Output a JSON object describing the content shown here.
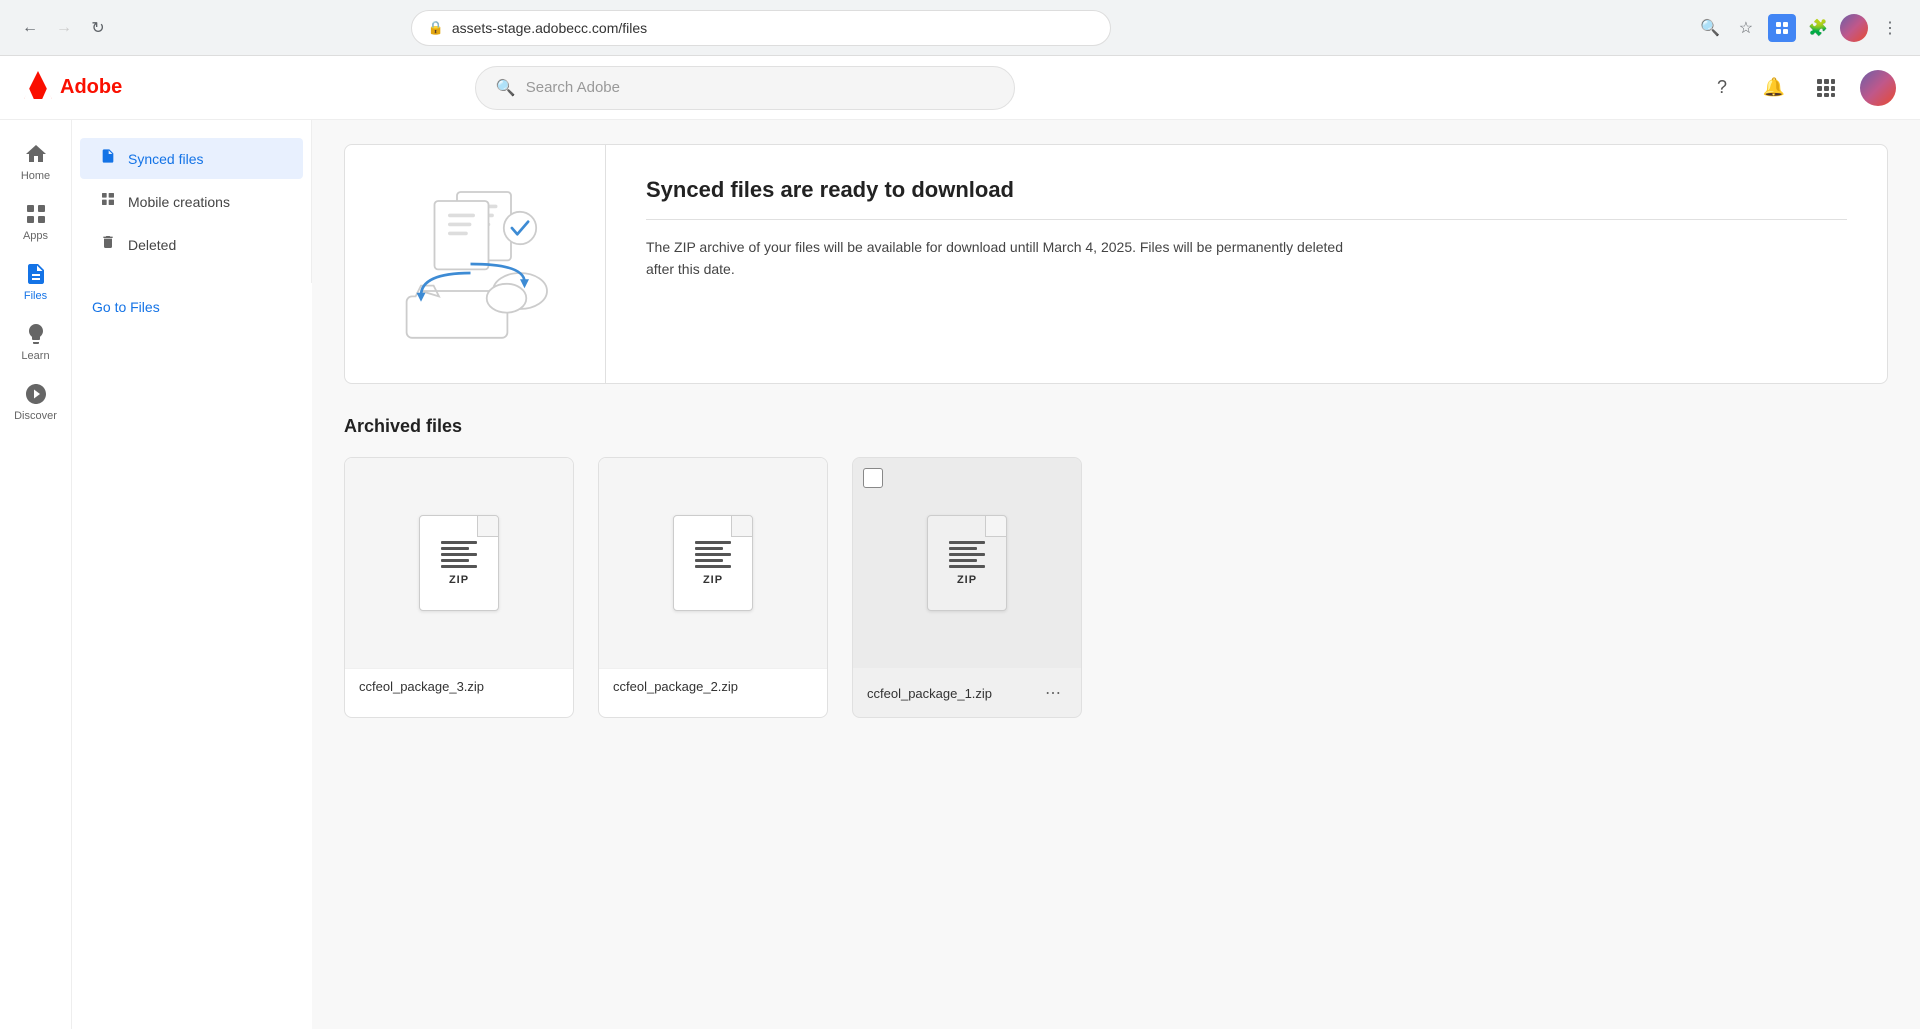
{
  "browser": {
    "url": "assets-stage.adobecc.com/files",
    "back_disabled": false,
    "forward_disabled": true
  },
  "header": {
    "logo_text": "Adobe",
    "search_placeholder": "Search Adobe"
  },
  "sidebar_icons": [
    {
      "id": "home",
      "label": "Home",
      "icon": "⌂",
      "active": false
    },
    {
      "id": "apps",
      "label": "Apps",
      "icon": "⊞",
      "active": false
    },
    {
      "id": "files",
      "label": "Files",
      "icon": "📄",
      "active": true
    },
    {
      "id": "learn",
      "label": "Learn",
      "icon": "💡",
      "active": false
    },
    {
      "id": "discover",
      "label": "Discover",
      "icon": "🧭",
      "active": false
    }
  ],
  "sidebar_nav": [
    {
      "id": "synced-files",
      "label": "Synced files",
      "icon": "doc",
      "active": true
    },
    {
      "id": "mobile-creations",
      "label": "Mobile creations",
      "icon": "grid",
      "active": false
    },
    {
      "id": "deleted",
      "label": "Deleted",
      "icon": "trash",
      "active": false
    }
  ],
  "go_to_files_label": "Go to Files",
  "banner": {
    "title": "Synced files are ready to download",
    "description": "The ZIP archive of your files will be available for download untill March 4, 2025. Files will be permanently deleted after this date."
  },
  "archived_section": {
    "title": "Archived files",
    "files": [
      {
        "id": "file-3",
        "name": "ccfeol_package_3.zip",
        "highlighted": false,
        "has_checkbox": false
      },
      {
        "id": "file-2",
        "name": "ccfeol_package_2.zip",
        "highlighted": false,
        "has_checkbox": false
      },
      {
        "id": "file-1",
        "name": "ccfeol_package_1.zip",
        "highlighted": true,
        "has_checkbox": true
      }
    ]
  }
}
